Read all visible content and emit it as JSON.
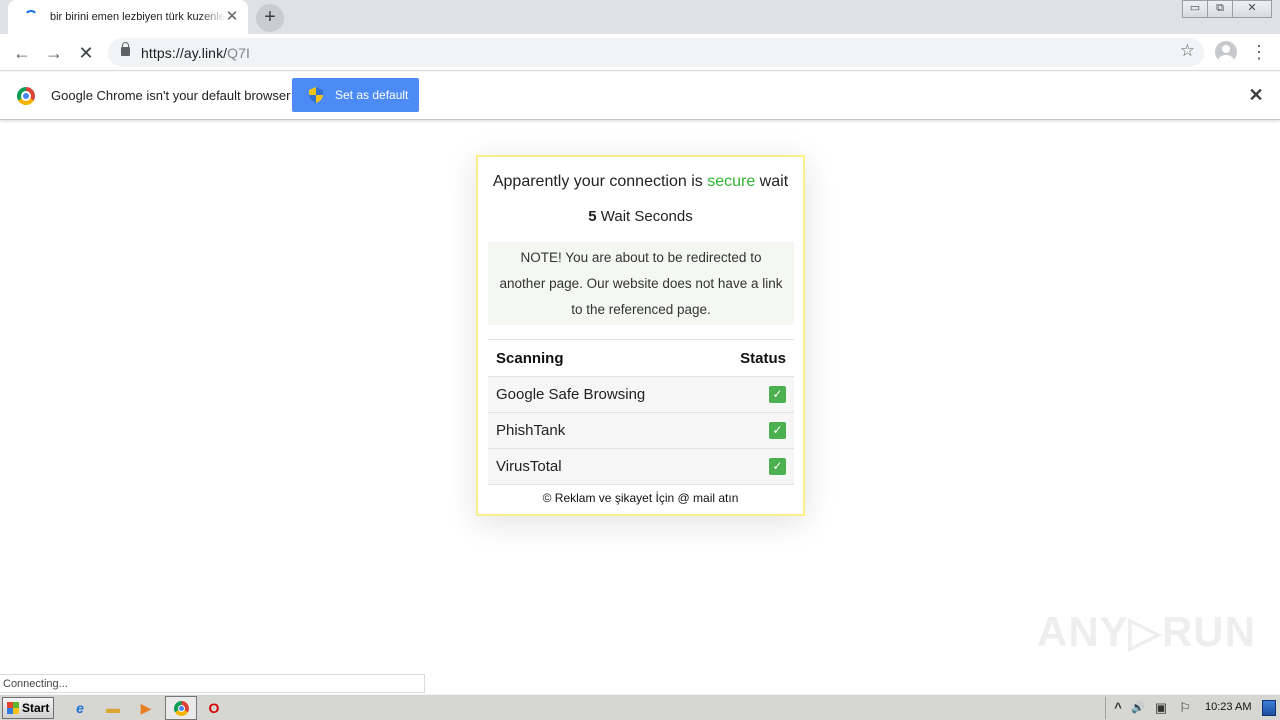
{
  "browser": {
    "tab_title": "bir birini emen lezbiyen türk kuzenler",
    "tab_close": "✕",
    "new_tab": "+",
    "window_controls": [
      "▭",
      "⧉",
      "✕"
    ],
    "url_host": "https://ay.link/",
    "url_path": "Q7I",
    "back_icon": "←",
    "forward_icon": "→",
    "stop_icon": "✕",
    "bookmark_icon": "☆",
    "menu_icon": "⋮"
  },
  "infobar": {
    "message": "Google Chrome isn't your default browser",
    "set_default_label": "Set as default",
    "close_icon": "✕"
  },
  "card": {
    "headline_prefix": "Apparently your connection is ",
    "headline_secure": "secure",
    "headline_suffix": " wait",
    "wait_count": "5",
    "wait_label": " Wait Seconds",
    "note": "NOTE! You are about to be redirected to another page. Our website does not have a link to the referenced page.",
    "table": {
      "col_scanning": "Scanning",
      "col_status": "Status",
      "rows": [
        {
          "name": "Google Safe Browsing",
          "status": "✓"
        },
        {
          "name": "PhishTank",
          "status": "✓"
        },
        {
          "name": "VirusTotal",
          "status": "✓"
        }
      ]
    },
    "footer": "© Reklam ve şikayet İçin @ mail atın"
  },
  "status_bar": "Connecting...",
  "watermark": "ANY▷RUN",
  "taskbar": {
    "start_label": "Start",
    "ie_icon": "e",
    "folder_icon": "▬",
    "media_icon": "▶",
    "opera_icon": "O",
    "clock": "10:23 AM",
    "tray_chevron": "^",
    "tray_sound": "🔊",
    "tray_network": "▣",
    "tray_flag": "⚐"
  },
  "colors": {
    "secure_green": "#2fb52f",
    "check_green": "#4caf50",
    "card_border": "#fbef8a",
    "button_blue": "#4c8bf5"
  }
}
